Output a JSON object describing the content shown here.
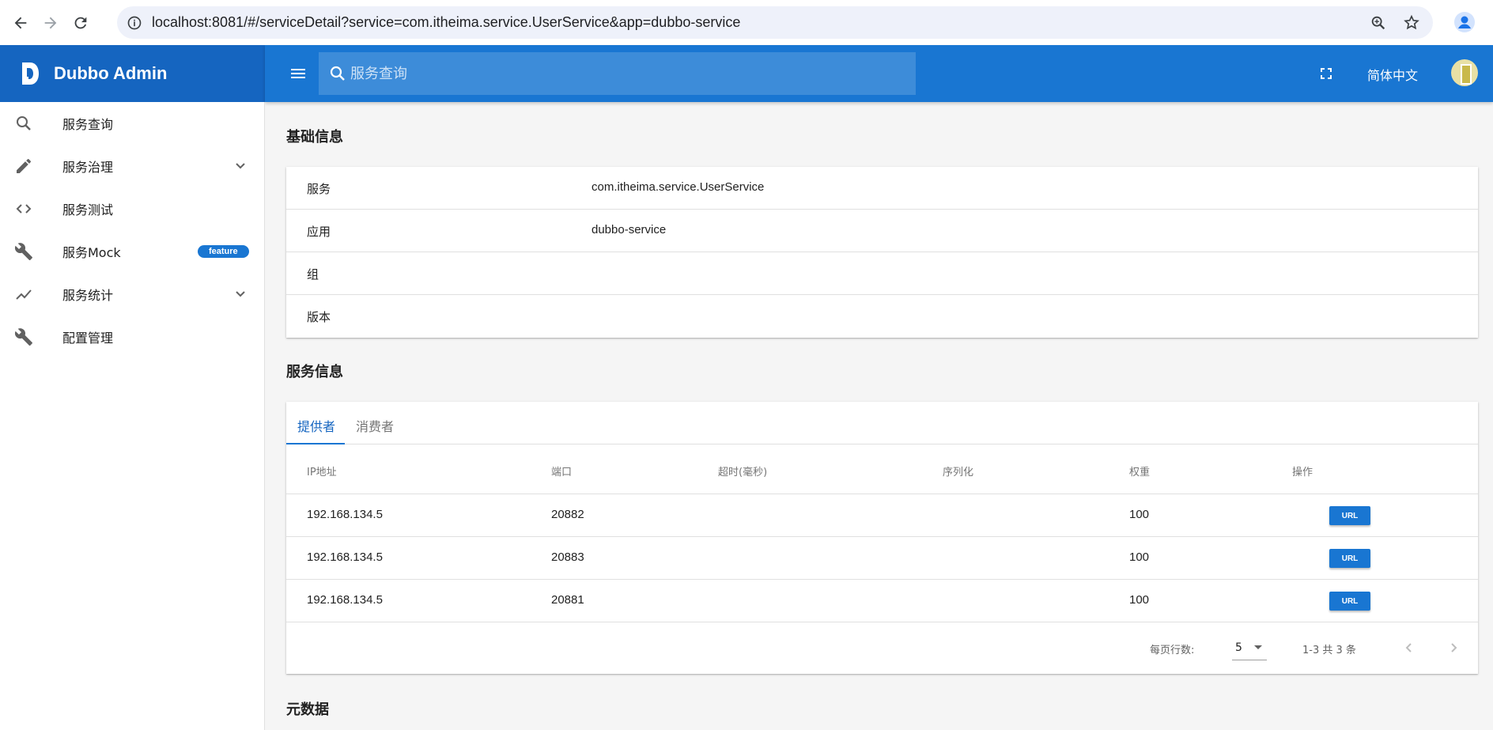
{
  "browser": {
    "url": "localhost:8081/#/serviceDetail?service=com.itheima.service.UserService&app=dubbo-service"
  },
  "app": {
    "title": "Dubbo Admin",
    "search_placeholder": "服务查询",
    "language": "简体中文",
    "brand_color": "#1565c0",
    "accent_color": "#1976d2"
  },
  "sidebar": {
    "items": [
      {
        "label": "服务查询",
        "icon": "search-icon"
      },
      {
        "label": "服务治理",
        "icon": "pencil-icon",
        "expandable": true
      },
      {
        "label": "服务测试",
        "icon": "code-icon"
      },
      {
        "label": "服务Mock",
        "icon": "wrench-icon",
        "badge": "feature"
      },
      {
        "label": "服务统计",
        "icon": "trending-icon",
        "expandable": true
      },
      {
        "label": "配置管理",
        "icon": "wrench-icon"
      }
    ]
  },
  "basic_info": {
    "title": "基础信息",
    "rows": [
      {
        "key": "服务",
        "value": "com.itheima.service.UserService"
      },
      {
        "key": "应用",
        "value": "dubbo-service"
      },
      {
        "key": "组",
        "value": ""
      },
      {
        "key": "版本",
        "value": ""
      }
    ]
  },
  "service_info": {
    "title": "服务信息",
    "tabs": [
      "提供者",
      "消费者"
    ],
    "columns": [
      "IP地址",
      "端口",
      "超时(毫秒)",
      "序列化",
      "权重",
      "操作"
    ],
    "rows": [
      {
        "ip": "192.168.134.5",
        "port": "20882",
        "timeout": "",
        "serialization": "",
        "weight": "100",
        "action": "URL"
      },
      {
        "ip": "192.168.134.5",
        "port": "20883",
        "timeout": "",
        "serialization": "",
        "weight": "100",
        "action": "URL"
      },
      {
        "ip": "192.168.134.5",
        "port": "20881",
        "timeout": "",
        "serialization": "",
        "weight": "100",
        "action": "URL"
      }
    ],
    "footer": {
      "rows_per_page_label": "每页行数:",
      "rows_per_page": "5",
      "range": "1-3 共 3 条"
    }
  },
  "metadata": {
    "title": "元数据"
  }
}
